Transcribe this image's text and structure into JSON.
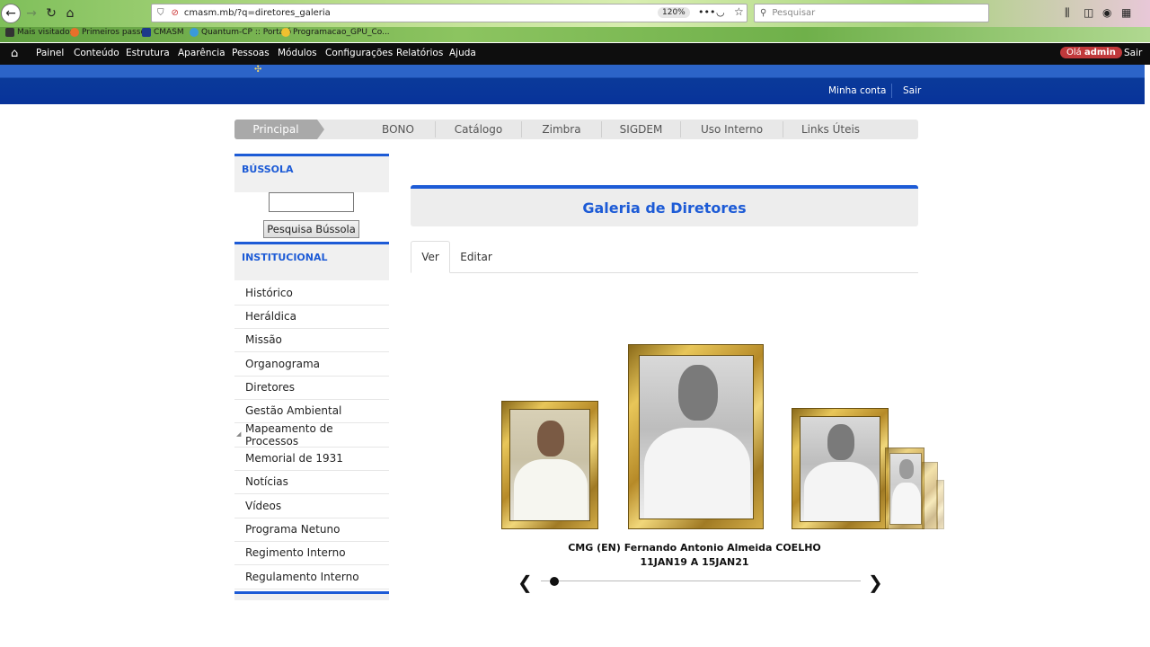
{
  "browser": {
    "url": "cmasm.mb/?q=diretores_galeria",
    "zoom": "120%",
    "search_placeholder": "Pesquisar",
    "bookmarks": [
      "Mais visitados",
      "Primeiros passos",
      "CMASM",
      "Quantum-CP :: Portaló",
      "Programacao_GPU_Co..."
    ]
  },
  "admin_toolbar": {
    "items": [
      "Painel",
      "Conteúdo",
      "Estrutura",
      "Aparência",
      "Pessoas",
      "Módulos",
      "Configurações",
      "Relatórios",
      "Ajuda"
    ],
    "hello": "Olá",
    "user": "admin",
    "logout": "Sair"
  },
  "header": {
    "my_account": "Minha conta",
    "logout": "Sair"
  },
  "main_nav": {
    "items": [
      "Principal",
      "BONO",
      "Catálogo",
      "Zimbra",
      "SIGDEM",
      "Uso Interno",
      "Links Úteis"
    ],
    "active": "Principal"
  },
  "sidebar": {
    "bussola_title": "BÚSSOLA",
    "bussola_button": "Pesquisa Bússola",
    "bussola_value": "",
    "institucional_title": "INSTITUCIONAL",
    "links": [
      "Histórico",
      "Heráldica",
      "Missão",
      "Organograma",
      "Diretores",
      "Gestão Ambiental",
      "Mapeamento de Processos",
      "Memorial de 1931",
      "Notícias",
      "Vídeos",
      "Programa Netuno",
      "Regimento Interno",
      "Regulamento Interno"
    ]
  },
  "content": {
    "title": "Galeria de Diretores",
    "tabs": [
      "Ver",
      "Editar"
    ],
    "active_tab": "Ver"
  },
  "gallery": {
    "caption_name": "CMG (EN) Fernando Antonio Almeida COELHO",
    "caption_dates": "11JAN19 A 15JAN21",
    "slider_position": 0.05
  },
  "colors": {
    "accent": "#1d5bd6",
    "header_blue": "#08339a",
    "admin_bar": "#0e0e0e",
    "hello_badge": "#c0393b"
  }
}
